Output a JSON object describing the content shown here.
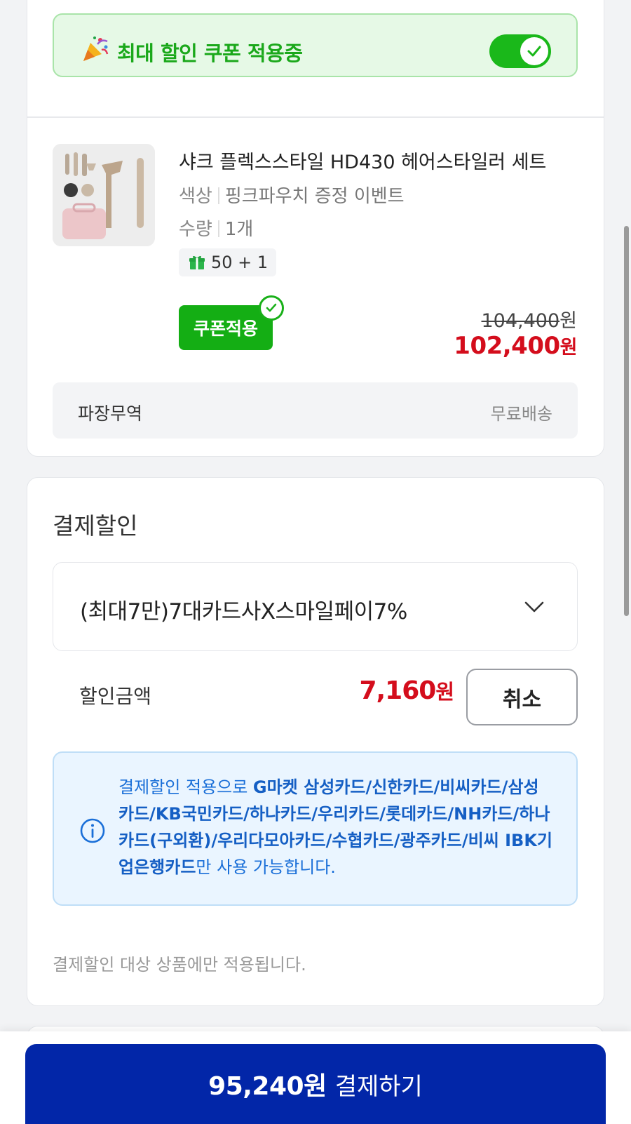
{
  "coupon_banner": {
    "icon": "party-popper-icon",
    "text": "최대 할인 쿠폰 적용중",
    "toggle_on": true
  },
  "product": {
    "title": "샤크 플렉스스타일 HD430 헤어스타일러 세트",
    "color_key": "색상",
    "color_value": "핑크파우치 증정 이벤트",
    "qty_key": "수량",
    "qty_value": "1개",
    "gift_badge": "50 + 1",
    "coupon_button": "쿠폰적용",
    "original_price": "104,400",
    "sale_price": "102,400",
    "won": "원"
  },
  "shipping": {
    "seller": "파장무역",
    "fee": "무료배송"
  },
  "payment_discount": {
    "title": "결제할인",
    "selected_option": "(최대7만)7대카드사X스마일페이7%",
    "amount_label": "할인금액",
    "amount": "7,160",
    "won": "원",
    "cancel_button": "취소",
    "info_prefix": "결제할인 적용으로 ",
    "info_cards": "G마켓 삼성카드/신한카드/비씨카드/삼성카드/KB국민카드/하나카드/우리카드/롯데카드/NH카드/하나카드(구외환)/우리다모아카드/수협카드/광주카드/비씨 IBK기업은행카드",
    "info_suffix": "만 사용 가능합니다.",
    "note": "결제할인 대상 상품에만 적용됩니다."
  },
  "checkout": {
    "amount": "95,240원",
    "label": "결제하기"
  },
  "colors": {
    "green": "#14ae14",
    "red": "#d40d1c",
    "blue": "#0226a8",
    "info_blue": "#1a6fd8"
  }
}
